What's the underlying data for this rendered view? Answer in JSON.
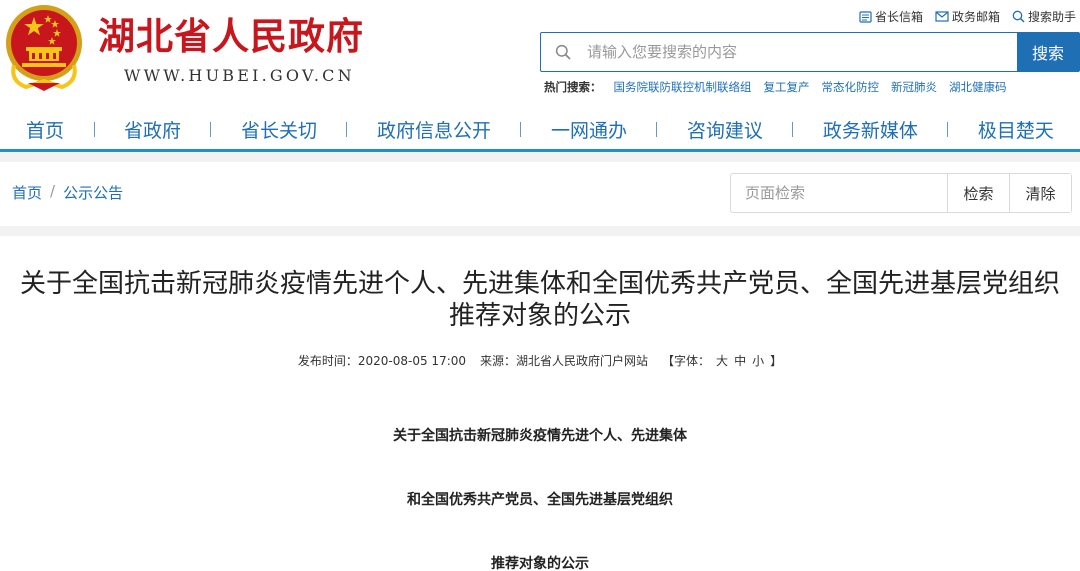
{
  "header": {
    "site_title": "湖北省人民政府",
    "site_domain": "WWW.HUBEI.GOV.CN",
    "brand_color": "#c8161d",
    "top_links": [
      {
        "label": "省长信箱",
        "icon": "mailbox-icon"
      },
      {
        "label": "政务邮箱",
        "icon": "envelope-icon"
      },
      {
        "label": "搜索助手",
        "icon": "search-icon"
      }
    ],
    "search": {
      "placeholder": "请输入您要搜索的内容",
      "button_label": "搜索"
    },
    "hot": {
      "label": "热门搜索：",
      "items": [
        "国务院联防联控机制联络组",
        "复工复产",
        "常态化防控",
        "新冠肺炎",
        "湖北健康码"
      ]
    }
  },
  "nav": {
    "accent": "#1f6fb5",
    "items": [
      "首页",
      "省政府",
      "省长关切",
      "政府信息公开",
      "一网通办",
      "咨询建议",
      "政务新媒体",
      "极目楚天"
    ]
  },
  "breadcrumb": {
    "items": [
      "首页",
      "公示公告"
    ],
    "separator": "/"
  },
  "page_search": {
    "placeholder": "页面检索",
    "search_label": "检索",
    "clear_label": "清除"
  },
  "article": {
    "title": "关于全国抗击新冠肺炎疫情先进个人、先进集体和全国优秀共产党员、全国先进基层党组织推荐对象的公示",
    "meta": {
      "published": "发布时间：2020-08-05 17:00",
      "source": "来源：湖北省人民政府门户网站",
      "font_label": "【字体：",
      "font_large": "大",
      "font_medium": "中",
      "font_small": "小",
      "font_close": "】"
    },
    "subtitles": [
      "关于全国抗击新冠肺炎疫情先进个人、先进集体",
      "和全国优秀共产党员、全国先进基层党组织",
      "推荐对象的公示"
    ]
  }
}
